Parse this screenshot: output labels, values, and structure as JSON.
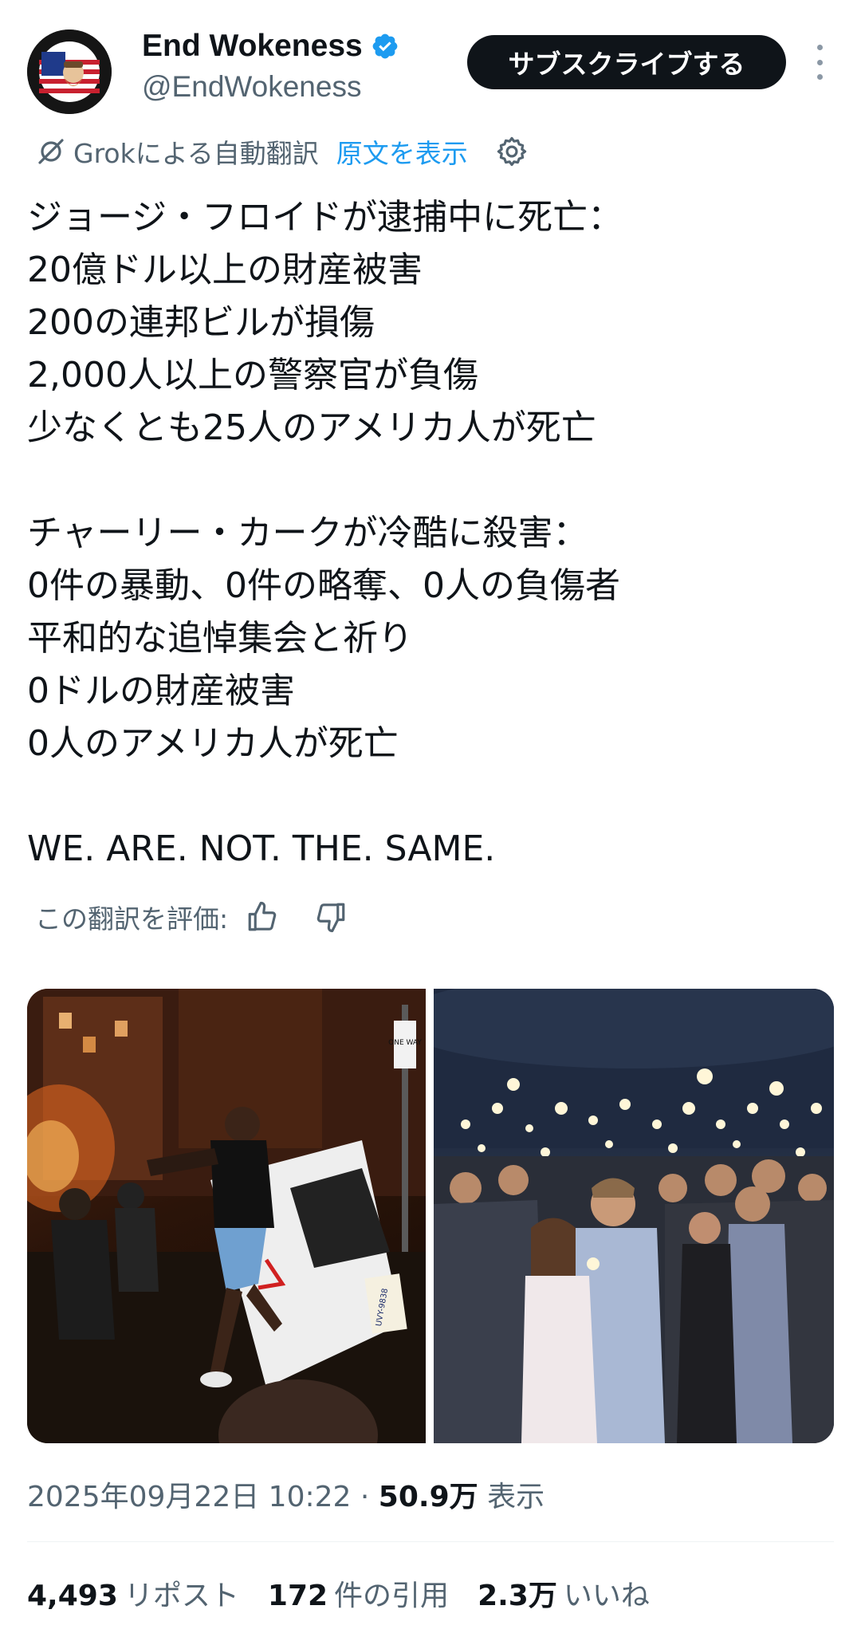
{
  "author": {
    "display_name": "End Wokeness",
    "handle": "@EndWokeness",
    "avatar_text_top": "I SUPPORT THE",
    "avatar_text_bottom": "FORMER THINGS",
    "verified_icon": "verified-badge-icon"
  },
  "header": {
    "subscribe_label": "サブスクライブする",
    "more_icon": "more-vertical-icon"
  },
  "translation": {
    "grok_label": "Grokによる自動翻訳",
    "show_original_label": "原文を表示",
    "settings_icon": "gear-icon"
  },
  "tweet": {
    "lines": [
      "ジョージ・フロイドが逮捕中に死亡：",
      "20億ドル以上の財産被害",
      "200の連邦ビルが損傷",
      "2,000人以上の警察官が負傷",
      "少なくとも25人のアメリカ人が死亡",
      "",
      "チャーリー・カークが冷酷に殺害：",
      "0件の暴動、0件の略奪、0人の負傷者",
      "平和的な追悼集会と祈り",
      "0ドルの財産被害",
      "0人のアメリカ人が死亡",
      "",
      "WE. ARE. NOT. THE. SAME."
    ]
  },
  "rating": {
    "label": "この翻訳を評価:",
    "thumbs_up_icon": "thumbs-up-icon",
    "thumbs_down_icon": "thumbs-down-icon"
  },
  "media": {
    "photos": [
      {
        "name": "riot-photo",
        "sign_text": "ONE WAY",
        "plate_text": "UVY-9838"
      },
      {
        "name": "vigil-photo"
      }
    ]
  },
  "meta": {
    "timestamp": "2025年09月22日 10:22",
    "separator": "·",
    "views_count": "50.9万",
    "views_label": "表示"
  },
  "stats": {
    "reposts_count": "4,493",
    "reposts_label": "リポスト",
    "quotes_count": "172",
    "quotes_label": "件の引用",
    "likes_count": "2.3万",
    "likes_label": "いいね"
  },
  "colors": {
    "accent": "#1d9bf0",
    "text": "#0f1419",
    "secondary": "#536471",
    "button_bg": "#0f1419"
  }
}
